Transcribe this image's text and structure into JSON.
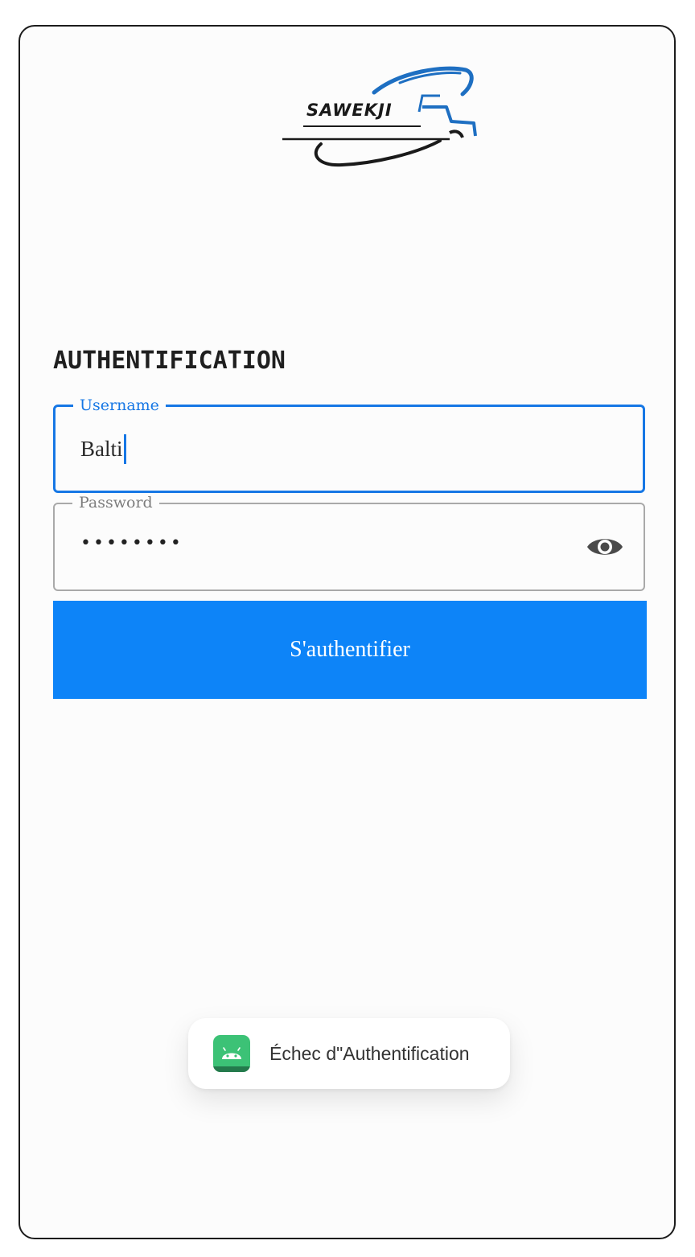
{
  "logo": {
    "text": "SAWEKJI",
    "color": "#1e6fc2"
  },
  "auth": {
    "title": "AUTHENTIFICATION"
  },
  "username": {
    "label": "Username",
    "value": "Balti"
  },
  "password": {
    "label": "Password",
    "masked_value": "••••••••",
    "toggle_icon": "eye-icon"
  },
  "login": {
    "label": "S'authentifier",
    "color": "#0d84f8"
  },
  "toast": {
    "icon": "android-icon",
    "message": "Échec d\"Authentification"
  },
  "colors": {
    "accent": "#1677e5",
    "background": "#fcfcfc"
  }
}
